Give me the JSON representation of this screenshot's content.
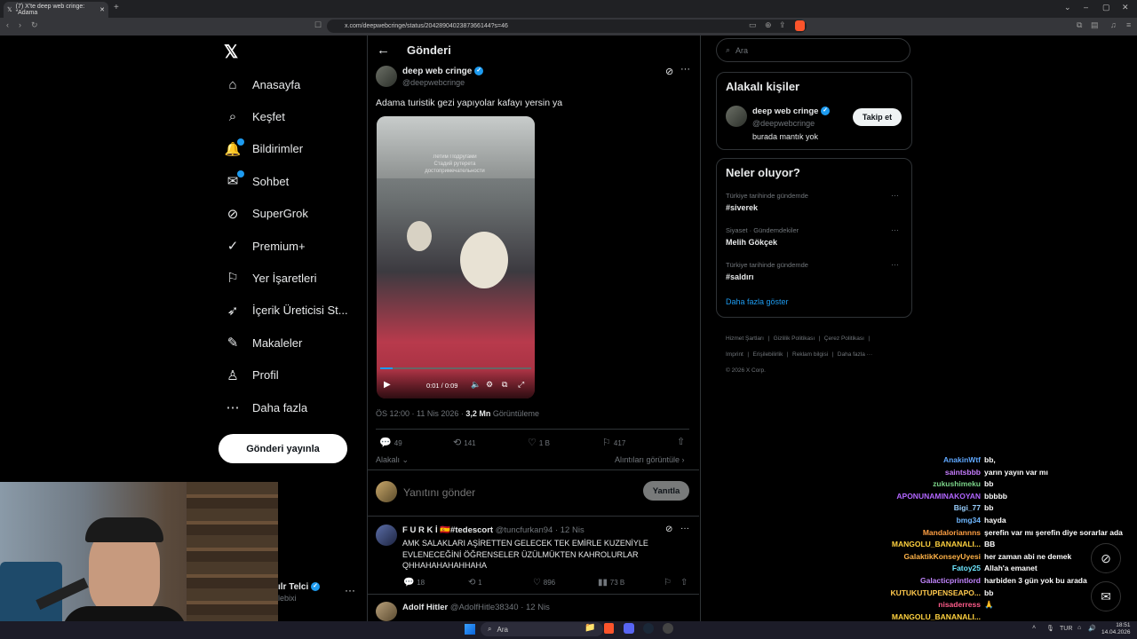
{
  "browser": {
    "tab_title": "(7) X'te deep web cringe: \"Adama",
    "url": "x.com/deepwebcringe/status/2042890402387366144?s=46"
  },
  "sidebar": {
    "items": [
      {
        "label": "Anasayfa",
        "icon": "home-icon"
      },
      {
        "label": "Keşfet",
        "icon": "search-icon"
      },
      {
        "label": "Bildirimler",
        "icon": "bell-icon",
        "badge": true
      },
      {
        "label": "Sohbet",
        "icon": "chat-icon",
        "badge": true
      },
      {
        "label": "SuperGrok",
        "icon": "grok-icon"
      },
      {
        "label": "Premium+",
        "icon": "verified-icon"
      },
      {
        "label": "Yer İşaretleri",
        "icon": "bookmark-icon"
      },
      {
        "label": "İçerik Üreticisi St...",
        "icon": "rocket-icon"
      },
      {
        "label": "Makaleler",
        "icon": "article-icon"
      },
      {
        "label": "Profil",
        "icon": "person-icon"
      },
      {
        "label": "Daha fazla",
        "icon": "more-circle-icon"
      }
    ],
    "post_button": "Gönderi yayınla",
    "account_name": "ılr Telci",
    "account_handle": "lebixi"
  },
  "main": {
    "header_title": "Gönderi",
    "post": {
      "author": "deep web cringe",
      "handle": "@deepwebcringe",
      "text": "Adama turistik gezi yapıyolar kafayı yersin ya",
      "video_time": "0:01 / 0:09",
      "timestamp": "ÖS 12:00 · 11 Nis 2026 · ",
      "views": "3,2 Mn",
      "views_label": "Görüntüleme",
      "replies": "49",
      "reposts": "141",
      "likes": "1 B",
      "bookmarks": "417",
      "relevance": "Alakalı",
      "quotes_link": "Alıntıları görüntüle"
    },
    "reply_box": {
      "placeholder": "Yanıtını gönder",
      "button": "Yanıtla"
    },
    "replies": [
      {
        "author": "F U R K İ 🇪🇸#tedescort",
        "handle": "@tuncfurkan94 · 12 Nis",
        "text": "AMK SALAKLARI AŞİRETTEN GELECEK TEK EMİRLE KUZENİYLE EVLENECEĞİNİ ÖĞRENSELER ÜZÜLMÜKTEN KAHROLURLAR QHHAHAHAHAHHAHA",
        "replies": "18",
        "reposts": "1",
        "likes": "896",
        "views": "73 B"
      },
      {
        "author": "Adolf Hitler",
        "handle": "@AdolfHitle38340 · 12 Nis"
      }
    ]
  },
  "right": {
    "search_placeholder": "Ara",
    "related_title": "Alakalı kişiler",
    "related": {
      "name": "deep web cringe",
      "handle": "@deepwebcringe",
      "bio": "burada mantık yok",
      "follow": "Takip et"
    },
    "trends_title": "Neler oluyor?",
    "trends": [
      {
        "category": "Türkiye tarihinde gündemde",
        "name": "#siverek"
      },
      {
        "category": "Siyaset · Gündemdekiler",
        "name": "Melih Gökçek"
      },
      {
        "category": "Türkiye tarihinde gündemde",
        "name": "#saldırı"
      }
    ],
    "show_more": "Daha fazla göster",
    "footer": [
      "Hizmet Şartları",
      "Gizlilik Politikası",
      "Çerez Politikası",
      "Imprint",
      "Erişilebilirlik",
      "Reklam bilgisi",
      "Daha fazla ···",
      "© 2026 X Corp."
    ]
  },
  "chat": [
    {
      "user": "AnakinWtf",
      "msg": "bb,",
      "color": "#5fa8ff"
    },
    {
      "user": "saintsbbb",
      "msg": "yarın yayın var mı",
      "color": "#c77dff"
    },
    {
      "user": "zukushimeku",
      "msg": "bb",
      "color": "#7bd389"
    },
    {
      "user": "APONUNAMINAKOYAN",
      "msg": "bbbbb",
      "color": "#b266ff"
    },
    {
      "user": "Bigi_77",
      "msg": "bb",
      "color": "#9ad0ff"
    },
    {
      "user": "bmg34",
      "msg": "hayda",
      "color": "#6fb7ff"
    },
    {
      "user": "Mandaloriannns",
      "msg": "şerefin var mı şerefin diye sorarlar adama 🐢",
      "color": "#ff9f43"
    },
    {
      "user": "MANGOLU_BANANALI...",
      "msg": "BB",
      "color": "#ffd23f"
    },
    {
      "user": "GalaktikKonseyUyesi",
      "msg": "her zaman abi ne demek",
      "color": "#ffb347"
    },
    {
      "user": "Fatoy25",
      "msg": "Allah'a emanet",
      "color": "#6ee7ff"
    },
    {
      "user": "Galacticprintlord",
      "msg": "harbiden 3 gün yok bu arada",
      "color": "#c084fc"
    },
    {
      "user": "KUTUKUTUPENSEAPO...",
      "msg": "bb",
      "color": "#ffc94d"
    },
    {
      "user": "nisaderress",
      "msg": "🙏",
      "color": "#ff5c8a"
    },
    {
      "user": "MANGOLU_BANANALI...",
      "msg": "",
      "color": "#ffd23f"
    }
  ],
  "taskbar": {
    "search": "Ara",
    "lang": "TUR",
    "time": "18:51",
    "date": "14.04.2026"
  }
}
